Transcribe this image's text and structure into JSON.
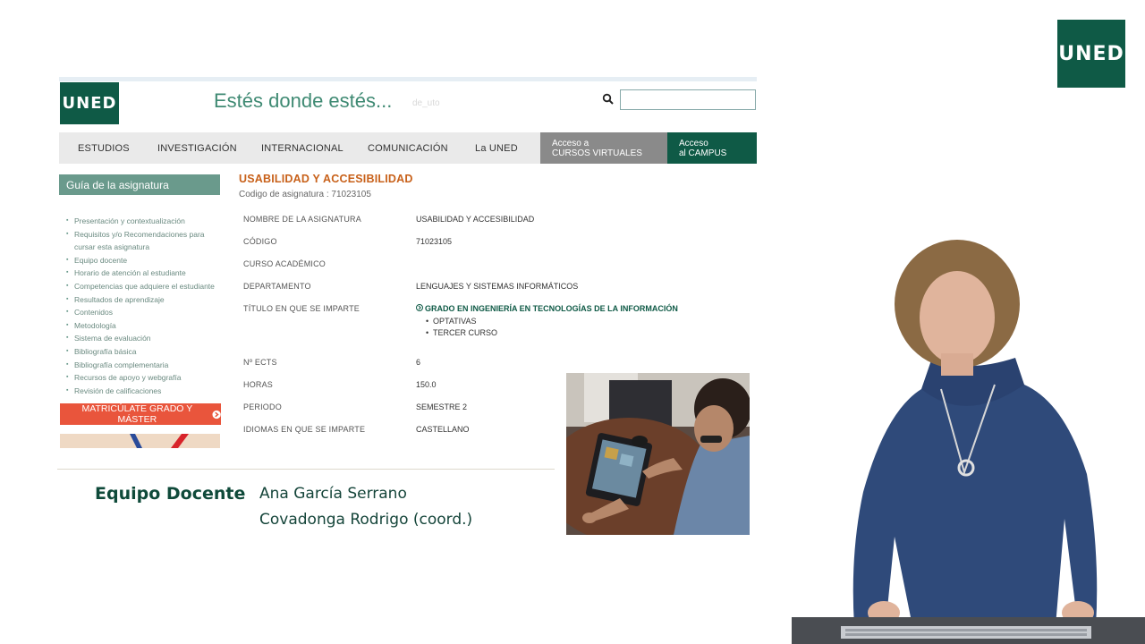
{
  "brand": {
    "logo_text": "UNED"
  },
  "site": {
    "logo_text": "UNED",
    "slogan": "Estés donde estés...",
    "slogan_faint": "de_uto",
    "search": {
      "value": "",
      "placeholder": ""
    },
    "nav": [
      "ESTUDIOS",
      "INVESTIGACIÓN",
      "INTERNACIONAL",
      "COMUNICACIÓN",
      "La UNED"
    ],
    "nav_virtual": {
      "line1": "Acceso a",
      "line2": "CURSOS VIRTUALES"
    },
    "nav_campus": {
      "line1": "Acceso",
      "line2": "al CAMPUS"
    },
    "sidebar": {
      "header": "Guía de la asignatura",
      "items": [
        "Presentación y contextualización",
        "Requisitos y/o Recomendaciones para cursar esta asignatura",
        "Equipo docente",
        "Horario de atención al estudiante",
        "Competencias que adquiere el estudiante",
        "Resultados de aprendizaje",
        "Contenidos",
        "Metodología",
        "Sistema de evaluación",
        "Bibliografía básica",
        "Bibliografía complementaria",
        "Recursos de apoyo y webgrafía",
        "Revisión de calificaciones"
      ],
      "enroll_button": "MATRICÚLATE GRADO Y MÁSTER"
    },
    "course": {
      "title": "USABILIDAD Y ACCESIBILIDAD",
      "code_line": "Codigo de asignatura : 71023105",
      "labels": {
        "name": "NOMBRE DE LA ASIGNATURA",
        "code": "CÓDIGO",
        "year": "CURSO ACADÉMICO",
        "dept": "DEPARTAMENTO",
        "degree": "TÍTULO EN QUE SE IMPARTE",
        "ects": "Nº ECTS",
        "hours": "HORAS",
        "period": "PERIODO",
        "languages": "IDIOMAS EN QUE SE IMPARTE"
      },
      "values": {
        "name": "USABILIDAD Y ACCESIBILIDAD",
        "code": "71023105",
        "year": "",
        "dept": "LENGUAJES Y SISTEMAS INFORMÁTICOS",
        "degree": "GRADO EN INGENIERÍA EN TECNOLOGÍAS DE LA INFORMACIÓN",
        "degree_sub": [
          "OPTATIVAS",
          "TERCER CURSO"
        ],
        "ects": "6",
        "hours": "150.0",
        "period": "SEMESTRE  2",
        "languages": "CASTELLANO"
      }
    }
  },
  "team": {
    "title": "Equipo Docente",
    "members": [
      "Ana García Serrano",
      "Covadonga Rodrigo (coord.)"
    ]
  },
  "colors": {
    "brand_green": "#0f5a46",
    "title_orange": "#c8611a",
    "enroll_red": "#e9553c",
    "nav_grey": "#8a8a8a"
  }
}
